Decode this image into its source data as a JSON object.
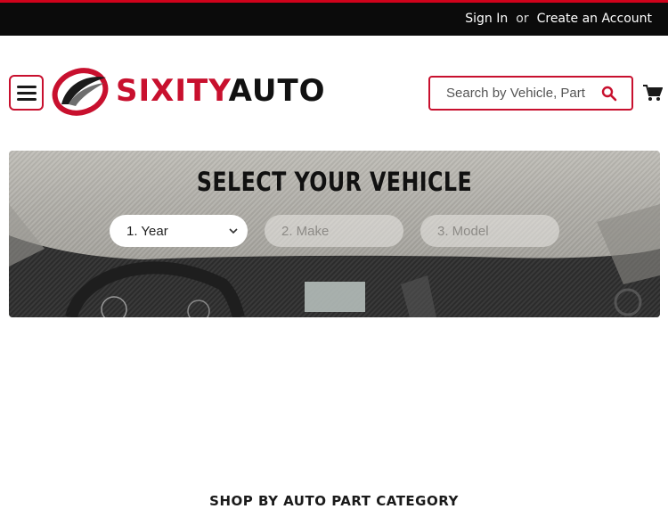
{
  "topbar": {
    "sign_in": "Sign In",
    "or": "or",
    "create_account": "Create an Account"
  },
  "header": {
    "logo_text_red": "SIXITY",
    "logo_text_black": "AUTO",
    "search_placeholder": "Search by Vehicle, Part"
  },
  "vehicle_selector": {
    "title": "SELECT YOUR VEHICLE",
    "year": "1. Year",
    "make": "2. Make",
    "model": "3. Model"
  },
  "category_heading": "SHOP BY AUTO PART CATEGORY",
  "colors": {
    "accent": "#c8102e",
    "topbar": "#0b0b0b"
  },
  "icons": {
    "menu": "hamburger-icon",
    "search": "search-icon",
    "cart": "cart-icon",
    "dropdown": "chevron-down-icon"
  }
}
